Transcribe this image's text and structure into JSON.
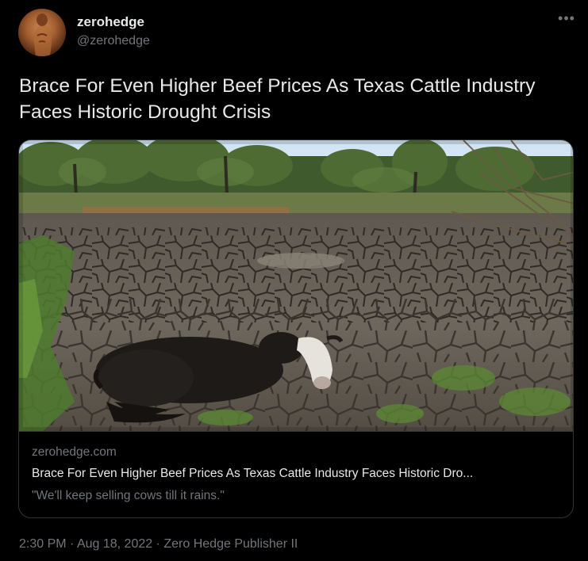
{
  "author": {
    "display_name": "zerohedge",
    "handle": "@zerohedge",
    "avatar_icon": "avatar-photo"
  },
  "more_icon": "more-horizontal-icon",
  "tweet": {
    "text": "Brace For Even Higher Beef Prices As Texas Cattle Industry Faces Historic Drought Crisis"
  },
  "card": {
    "domain": "zerohedge.com",
    "title": "Brace For Even Higher Beef Prices As Texas Cattle Industry Faces Historic Dro...",
    "description": "\"We'll keep selling cows till it rains.\""
  },
  "meta": {
    "time": "2:30 PM",
    "separator": "·",
    "date": "Aug 18, 2022",
    "source": "Zero Hedge Publisher II"
  },
  "colors": {
    "background": "#000000",
    "text_primary": "#e7e9ea",
    "text_secondary": "#71767b",
    "border": "#2f3336"
  }
}
